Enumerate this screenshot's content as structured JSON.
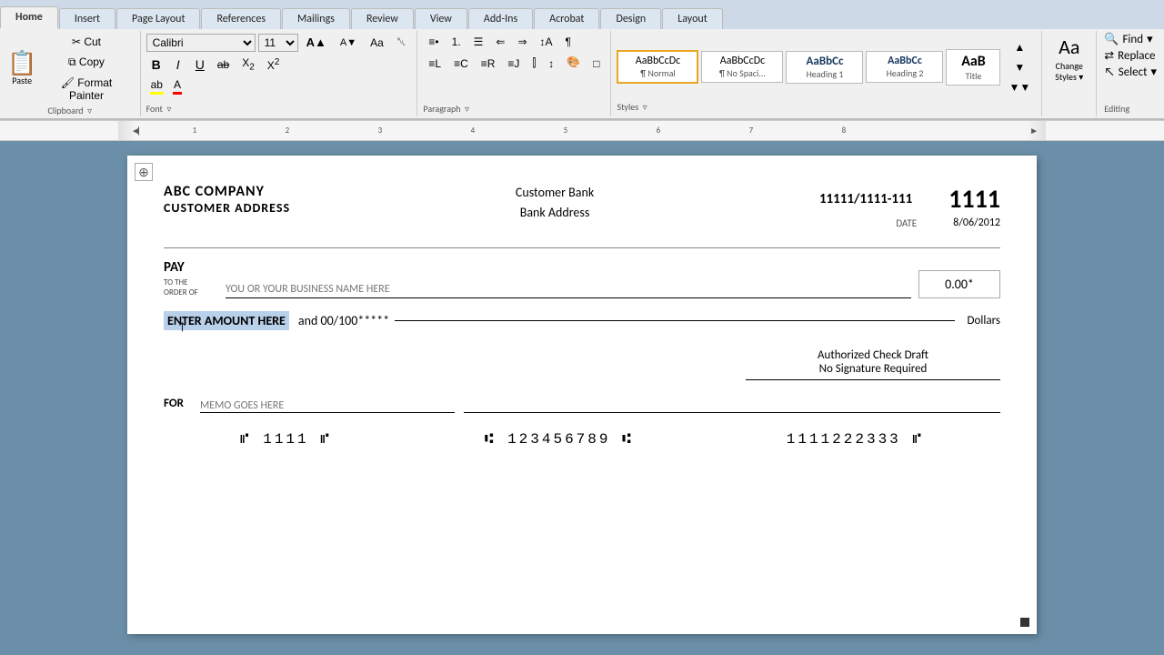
{
  "tabs": [
    {
      "label": "Home",
      "active": true
    },
    {
      "label": "Insert",
      "active": false
    },
    {
      "label": "Page Layout",
      "active": false
    },
    {
      "label": "References",
      "active": false
    },
    {
      "label": "Mailings",
      "active": false
    },
    {
      "label": "Review",
      "active": false
    },
    {
      "label": "View",
      "active": false
    },
    {
      "label": "Add-Ins",
      "active": false
    },
    {
      "label": "Acrobat",
      "active": false
    },
    {
      "label": "Design",
      "active": false
    },
    {
      "label": "Layout",
      "active": false
    }
  ],
  "font": {
    "name": "Calibri",
    "size": "11",
    "bold": "B",
    "italic": "I",
    "underline": "U",
    "strikethrough": "ab",
    "subscript": "X₂",
    "superscript": "X²",
    "clearFormat": "Aa",
    "fontColor": "A",
    "highlight": "ab"
  },
  "styles": {
    "normal_label": "AaBbCcDc",
    "normal_sub": "¶ Normal",
    "nospace_label": "AaBbCcDc",
    "nospace_sub": "¶ No Spaci...",
    "h1_label": "AaBbCc",
    "h1_sub": "Heading 1",
    "h2_label": "AaBbCc",
    "h2_sub": "Heading 2",
    "title_label": "AaB",
    "title_sub": "Title",
    "change_styles": "Change\nStyles"
  },
  "editing": {
    "find": "Find",
    "replace": "Replace",
    "select": "Select"
  },
  "groups": {
    "font_label": "Font",
    "paragraph_label": "Paragraph",
    "styles_label": "Styles",
    "editing_label": "Editing"
  },
  "check": {
    "company_name": "ABC COMPANY",
    "company_address": "CUSTOMER ADDRESS",
    "bank_name": "Customer Bank",
    "bank_address": "Bank Address",
    "routing": "11111/1111-111",
    "date_label": "DATE",
    "date_value": "8/06/2012",
    "check_number": "1111",
    "pay_label": "PAY",
    "to_the_order": "TO THE\nORDER OF",
    "payee_placeholder": "YOU OR YOUR BUSINESS NAME HERE",
    "amount": "0.00*",
    "amount_text_highlight": "ENTER AMOUNT HERE",
    "amount_suffix": "and 00/100*****",
    "dollars": "Dollars",
    "authorized_line1": "Authorized Check Draft",
    "authorized_line2": "No Signature Required",
    "for_label": "FOR",
    "memo_placeholder": "MEMO GOES HERE",
    "micr_check": "⑈ 1111 ⑈",
    "micr_routing": "⑆ 123456789 ⑆",
    "micr_account": "1111222333 ⑈"
  }
}
